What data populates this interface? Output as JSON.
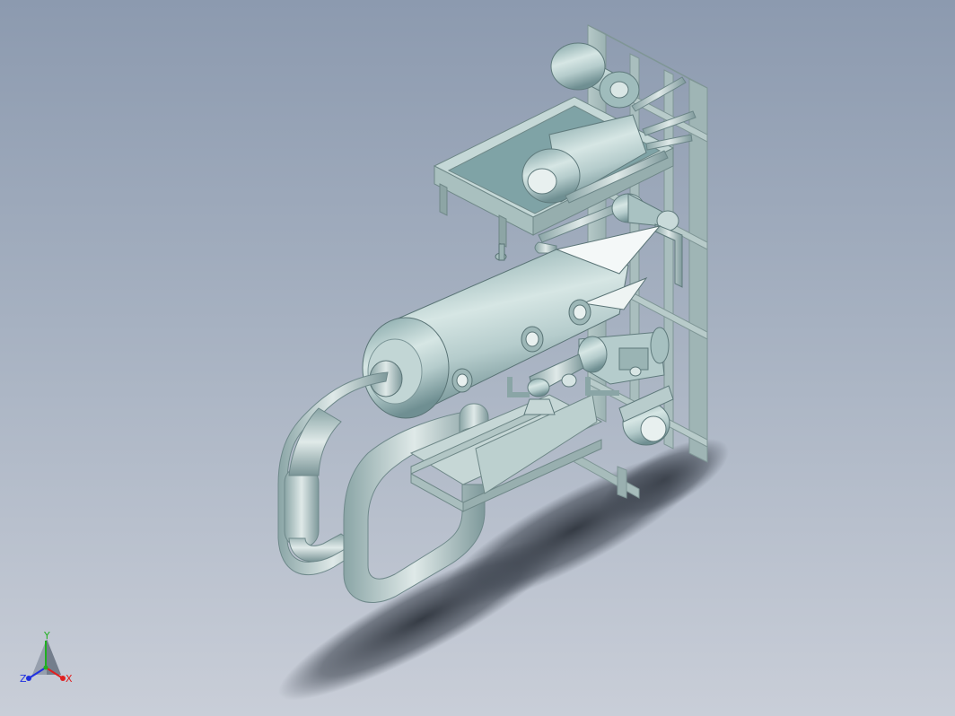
{
  "viewport": {
    "background_top": "#8c9aaf",
    "background_bottom": "#c9ced8"
  },
  "model": {
    "icon": "3d-assembly-model",
    "body_color": "#b9cfcf",
    "shadow_color": "#3e4550"
  },
  "triad": {
    "x_label": "X",
    "y_label": "Y",
    "z_label": "Z",
    "x_color": "#e02020",
    "y_color": "#20b020",
    "z_color": "#2030e0"
  }
}
